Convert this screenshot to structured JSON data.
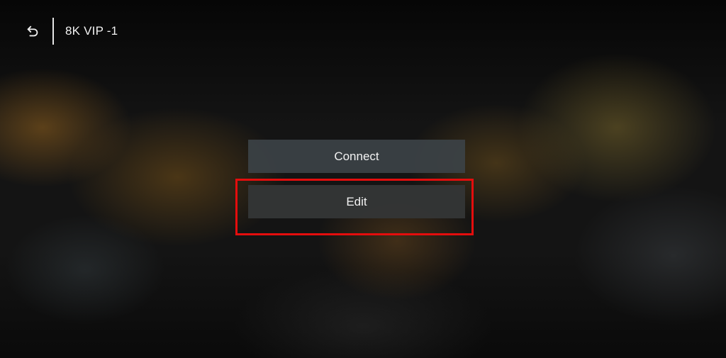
{
  "header": {
    "back_icon": "back-arrow-icon",
    "title": "8K VIP -1"
  },
  "menu": {
    "items": [
      {
        "label": "Connect"
      },
      {
        "label": "Edit"
      }
    ]
  },
  "annotation": {
    "highlight_color": "#e40d0d",
    "highlighted_item": "Edit"
  }
}
